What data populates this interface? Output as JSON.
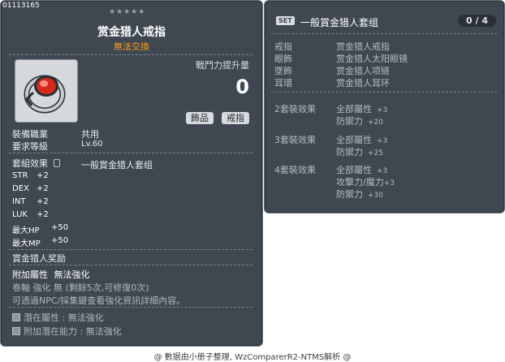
{
  "item": {
    "id": "01113165",
    "stars": "★★★★★",
    "name": "赏金猎人戒指",
    "trade": "無法交換",
    "power_label": "戰鬥力提升量",
    "power_value": "0",
    "tags": [
      "飾品",
      "戒指"
    ],
    "job_label": "裝備職業",
    "job_value": "共用",
    "level_label": "要求等級",
    "level_value": "Lv.60",
    "set_effect_label": "套組效果",
    "set_effect_value": "一般賞金猎人套组",
    "stats": [
      {
        "name": "STR",
        "value": "+2"
      },
      {
        "name": "DEX",
        "value": "+2"
      },
      {
        "name": "INT",
        "value": "+2"
      },
      {
        "name": "LUK",
        "value": "+2"
      },
      {
        "name": "最大HP",
        "value": "+50"
      },
      {
        "name": "最大MP",
        "value": "+50"
      }
    ],
    "reward": "賞金猎人奖励",
    "additional_label": "附加屬性",
    "additional_value": "無法強化",
    "scroll_line": "卷軸 強化 無 (剩餘5次,可修復0次)",
    "npc_line": "可透過NPC/採集鍵查看強化資訊詳細內容。",
    "potential": "潛在屬性 : 無法強化",
    "add_potential": "附加潛在能力 : 無法強化"
  },
  "set": {
    "badge": "SET",
    "title": "一般賞金猎人套组",
    "count": "0 / 4",
    "parts": [
      {
        "slot": "戒指",
        "name": "赏金猎人戒指"
      },
      {
        "slot": "眼飾",
        "name": "赏金猎人太阳眼镜"
      },
      {
        "slot": "墜飾",
        "name": "赏金猎人项链"
      },
      {
        "slot": "耳環",
        "name": "赏金猎人耳环"
      }
    ],
    "effects": [
      {
        "label": "2套裝效果",
        "lines": [
          {
            "t": "全部屬性",
            "v": "+3"
          },
          {
            "t": "防禦力",
            "v": "+20"
          }
        ]
      },
      {
        "label": "3套裝效果",
        "lines": [
          {
            "t": "全部屬性",
            "v": "+3"
          },
          {
            "t": "防禦力",
            "v": "+25"
          }
        ]
      },
      {
        "label": "4套裝效果",
        "lines": [
          {
            "t": "全部屬性",
            "v": "+3"
          },
          {
            "t": "攻擊力/魔力",
            "v": "+3"
          },
          {
            "t": "防禦力",
            "v": "+30"
          }
        ]
      }
    ]
  },
  "footer": "@ 數据由小册子整理, WzComparerR2-NTMS解析 @",
  "colors": {
    "panel": "#3f4750",
    "trade": "#ff9c1a",
    "text": "#e8ecef"
  }
}
